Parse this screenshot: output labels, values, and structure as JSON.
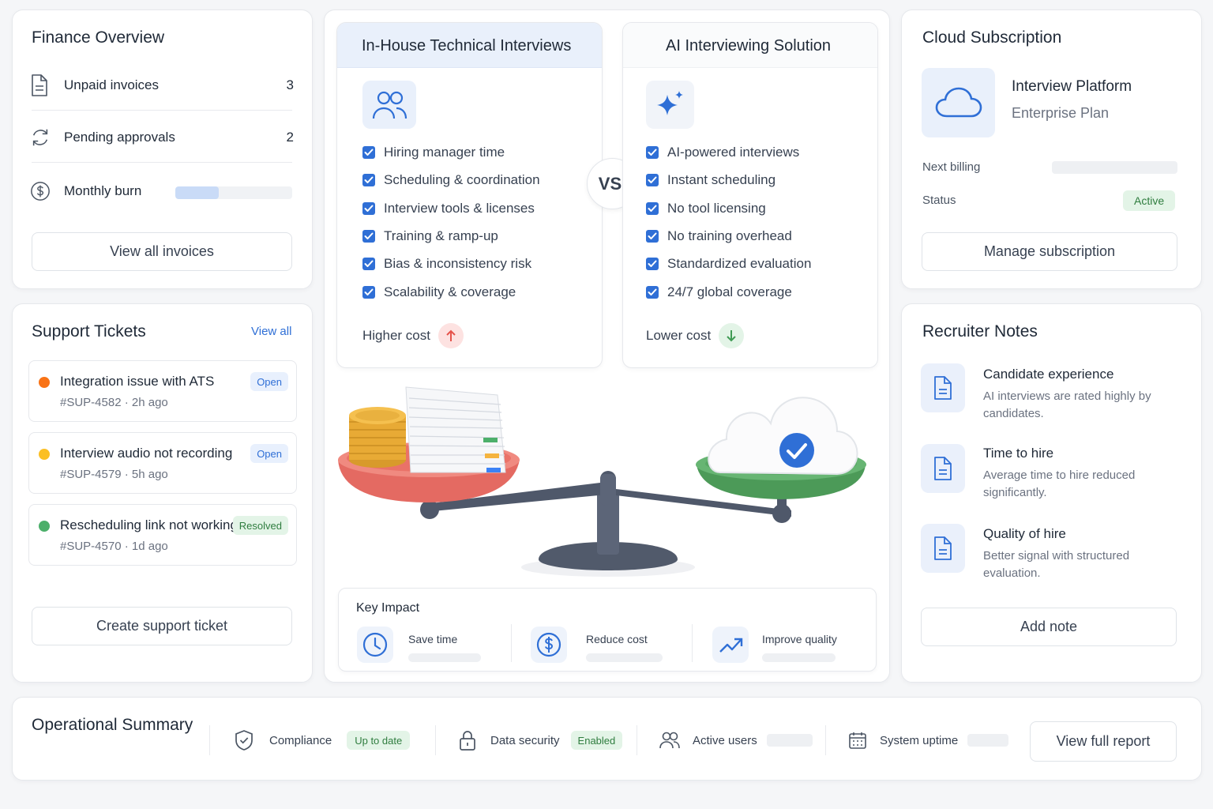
{
  "finance": {
    "title": "Finance Overview",
    "rows": [
      {
        "label": "Unpaid invoices",
        "value": "3",
        "icon": "document-icon"
      },
      {
        "label": "Pending approvals",
        "value": "2",
        "icon": "refresh-icon"
      },
      {
        "label": "Monthly burn",
        "icon": "dollar-icon",
        "progress": 0.37
      }
    ],
    "button": "View all invoices"
  },
  "support": {
    "title": "Support Tickets",
    "view_all": "View all",
    "tickets": [
      {
        "title": "Integration issue with ATS",
        "meta": "#SUP-4582 · 2h ago",
        "status": "Open",
        "dot": "#f97316"
      },
      {
        "title": "Interview audio not recording",
        "meta": "#SUP-4579 · 5h ago",
        "status": "Open",
        "dot": "#fbbf24"
      },
      {
        "title": "Rescheduling link not working",
        "meta": "#SUP-4570 · 1d ago",
        "status": "Resolved",
        "dot": "#4caf6a"
      }
    ],
    "button": "Create support ticket"
  },
  "comparison": {
    "left": {
      "title": "In-House Technical Interviews",
      "icon": "people-icon",
      "items": [
        "Hiring manager time",
        "Scheduling & coordination",
        "Interview tools & licenses",
        "Training & ramp-up",
        "Bias & inconsistency risk",
        "Scalability & coverage"
      ],
      "cost": "Higher cost"
    },
    "vs": "VS.",
    "right": {
      "title": "AI Interviewing Solution",
      "icon": "sparkle-icon",
      "items": [
        "AI-powered interviews",
        "Instant scheduling",
        "No tool licensing",
        "No training overhead",
        "Standardized evaluation",
        "24/7 global coverage"
      ],
      "cost": "Lower cost"
    }
  },
  "key_impact": {
    "title": "Key Impact",
    "items": [
      {
        "label": "Save time",
        "icon": "clock-icon"
      },
      {
        "label": "Reduce cost",
        "icon": "dollar-icon"
      },
      {
        "label": "Improve quality",
        "icon": "trend-up-icon"
      }
    ]
  },
  "subscription": {
    "title": "Cloud Subscription",
    "product": "Interview Platform",
    "plan": "Enterprise Plan",
    "next_billing_label": "Next billing",
    "status_label": "Status",
    "status_value": "Active",
    "button": "Manage subscription"
  },
  "notes": {
    "title": "Recruiter Notes",
    "items": [
      {
        "title": "Candidate experience",
        "desc": "AI interviews are rated highly by candidates."
      },
      {
        "title": "Time to hire",
        "desc": "Average time to hire reduced significantly."
      },
      {
        "title": "Quality of hire",
        "desc": "Better signal with structured evaluation."
      }
    ],
    "button": "Add note"
  },
  "operational": {
    "title": "Operational Summary",
    "compliance": {
      "label": "Compliance",
      "badge": "Up to date"
    },
    "security": {
      "label": "Data security",
      "badge": "Enabled"
    },
    "users": {
      "label": "Active users"
    },
    "uptime": {
      "label": "System uptime"
    },
    "button": "View full report"
  },
  "colors": {
    "accent": "#2f6fd6",
    "danger": "#e5534b",
    "success": "#3f9b54"
  }
}
